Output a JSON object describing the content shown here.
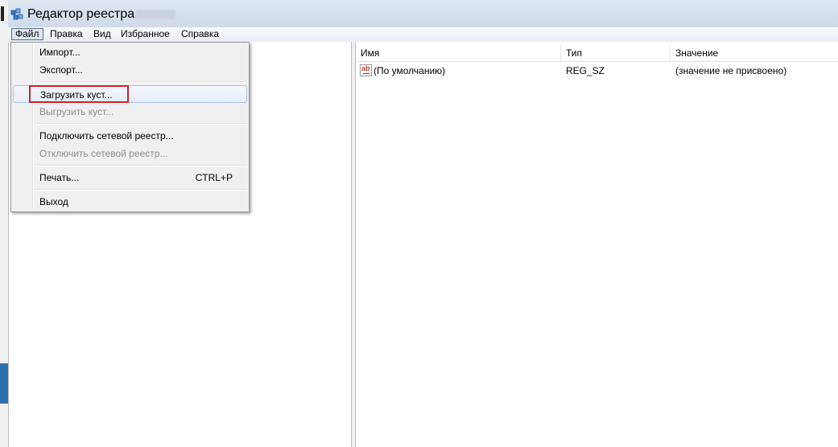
{
  "window": {
    "title": "Редактор реестра"
  },
  "menubar": {
    "items": [
      {
        "label": "Файл"
      },
      {
        "label": "Правка"
      },
      {
        "label": "Вид"
      },
      {
        "label": "Избранное"
      },
      {
        "label": "Справка"
      }
    ]
  },
  "file_menu": {
    "items": [
      {
        "label": "Импорт...",
        "enabled": true
      },
      {
        "label": "Экспорт...",
        "enabled": true
      },
      {
        "label": "Загрузить куст...",
        "enabled": true
      },
      {
        "label": "Выгрузить куст...",
        "enabled": false
      },
      {
        "label": "Подключить сетевой реестр...",
        "enabled": true
      },
      {
        "label": "Отключить сетевой реестр...",
        "enabled": false
      },
      {
        "label": "Печать...",
        "shortcut": "CTRL+P",
        "enabled": true
      },
      {
        "label": "Выход",
        "enabled": true
      }
    ]
  },
  "values_list": {
    "columns": [
      "Имя",
      "Тип",
      "Значение"
    ],
    "rows": [
      {
        "icon": "string-value-icon",
        "name": "(По умолчанию)",
        "type": "REG_SZ",
        "value": "(значение не присвоено)"
      }
    ]
  },
  "colors": {
    "highlight": "#d0202a",
    "menu_hover": "#a9c3e8",
    "titlebar": "#dfe7f1"
  }
}
